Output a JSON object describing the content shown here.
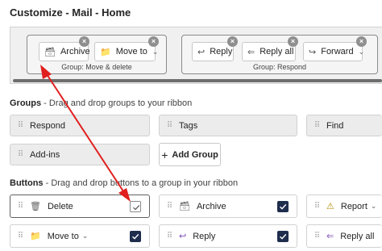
{
  "page": {
    "title": "Customize - Mail - Home"
  },
  "ribbon": {
    "group1": {
      "caption": "Group: Move & delete",
      "buttons": [
        {
          "label": "Archive",
          "icon": "archive-icon"
        },
        {
          "label": "Move to",
          "icon": "move-to-folder-icon"
        }
      ]
    },
    "group2": {
      "caption": "Group: Respond",
      "buttons": [
        {
          "label": "Reply",
          "icon": "reply-icon"
        },
        {
          "label": "Reply all",
          "icon": "reply-all-icon"
        },
        {
          "label": "Forward",
          "icon": "forward-icon"
        }
      ]
    },
    "remove_glyph": "×"
  },
  "groups_section": {
    "heading": "Groups",
    "hint": " - Drag and drop groups to your ribbon",
    "items": [
      "Respond",
      "Tags",
      "Find",
      "Add-ins"
    ],
    "add_group_label": "Add Group"
  },
  "buttons_section": {
    "heading": "Buttons",
    "hint": " - Drag and drop buttons to a group in your ribbon",
    "items": [
      {
        "label": "Delete",
        "icon": "trash-icon",
        "checked": false
      },
      {
        "label": "Archive",
        "icon": "archive-icon",
        "checked": true
      },
      {
        "label": "Report",
        "icon": "warning-icon",
        "checked": false
      },
      {
        "label": "Move to",
        "icon": "move-to-folder-icon",
        "checked": true
      },
      {
        "label": "Reply",
        "icon": "reply-icon",
        "checked": true
      },
      {
        "label": "Reply all",
        "icon": "reply-all-icon",
        "checked": false
      }
    ]
  },
  "colors": {
    "checked": "#1f2d4d",
    "arrow": "#e0201f"
  }
}
